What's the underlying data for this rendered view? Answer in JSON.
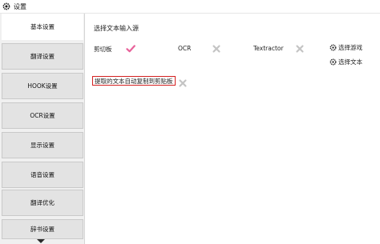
{
  "window": {
    "title": "设置"
  },
  "sidebar": {
    "items": [
      {
        "label": "基本设置",
        "active": true
      },
      {
        "label": "翻译设置"
      },
      {
        "label": "HOOK设置"
      },
      {
        "label": "OCR设置"
      },
      {
        "label": "显示设置"
      },
      {
        "label": "语音设置"
      },
      {
        "label": "翻译优化"
      },
      {
        "label": "辞书设置"
      }
    ]
  },
  "main": {
    "section_title": "选择文本输入源",
    "sources": [
      {
        "label": "剪切板",
        "state": "checked"
      },
      {
        "label": "OCR",
        "state": "unchecked"
      },
      {
        "label": "Textractor",
        "state": "unchecked"
      }
    ],
    "select_game_label": "选择游戏",
    "select_text_label": "选择文本",
    "auto_copy_label": "提取的文本自动复制到剪贴板",
    "auto_copy_state": "unchecked"
  },
  "colors": {
    "check": "#e8629a",
    "cross": "#c4c4c4",
    "highlight_border": "#d32020"
  }
}
